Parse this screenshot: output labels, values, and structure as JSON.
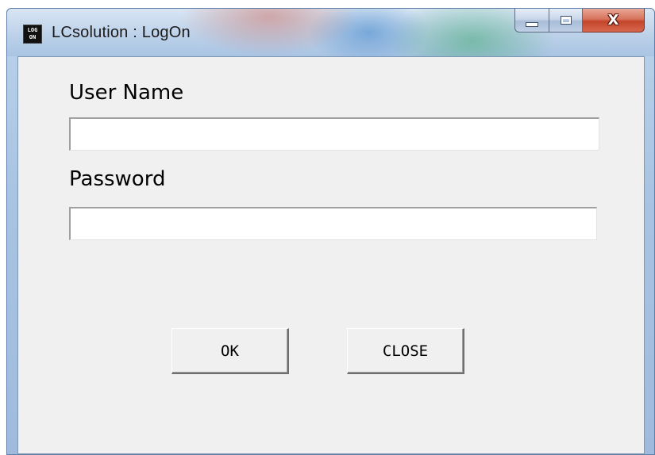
{
  "window": {
    "title": "LCsolution : LogOn",
    "icon_line1": "LOG",
    "icon_line2": "ON",
    "icon_name": "logon-app-icon"
  },
  "caption": {
    "minimize_icon": "minimize-icon",
    "maximize_icon": "maximize-icon",
    "close_glyph": "X"
  },
  "form": {
    "username_label": "User Name",
    "username_value": "",
    "password_label": "Password",
    "password_value": ""
  },
  "buttons": {
    "ok_label": "OK",
    "close_label": "CLOSE"
  },
  "colors": {
    "client_bg": "#f0f0f0",
    "close_button_red": "#c2452b"
  }
}
